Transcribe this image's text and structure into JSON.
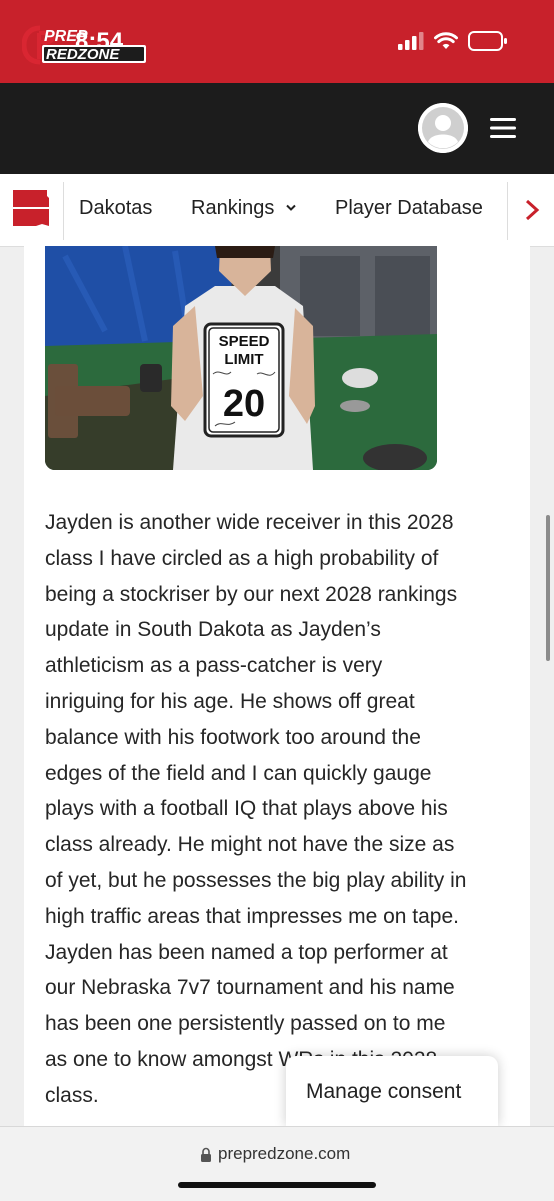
{
  "status_bar": {
    "time": "8:54"
  },
  "header": {
    "logo_line1": "PREP",
    "logo_line2": "REDZONE"
  },
  "nav": {
    "items": [
      {
        "label": "Dakotas"
      },
      {
        "label": "Rankings"
      },
      {
        "label": "Player Database"
      }
    ]
  },
  "photo": {
    "sign_line1": "SPEED",
    "sign_line2": "LIMIT",
    "sign_number": "20"
  },
  "article": {
    "lines": [
      "Jayden is another wide receiver in this 2028",
      "class I have circled as a high probability of",
      "being a stockriser by our next 2028 rankings",
      "update in South Dakota as Jayden’s",
      "athleticism as a pass-catcher is very",
      "inriguing for his age. He shows off great",
      "balance with his footwork too around the",
      "edges of the field and I can quickly gauge",
      "plays with a football IQ that plays above his",
      "class already. He might not have the size as",
      "of yet, but he possesses the big play ability in",
      "high traffic areas that impresses me on tape.",
      "Jayden has been named a top performer at",
      "our Nebraska 7v7 tournament and his name",
      "has been one persistently passed on to me",
      "as one to know amongst WRs in this 2028",
      "class."
    ]
  },
  "consent": {
    "label": "Manage consent"
  },
  "browser": {
    "url": "prepredzone.com"
  },
  "colors": {
    "brand_red": "#c8212b",
    "header_dark": "#1c1c1c"
  }
}
